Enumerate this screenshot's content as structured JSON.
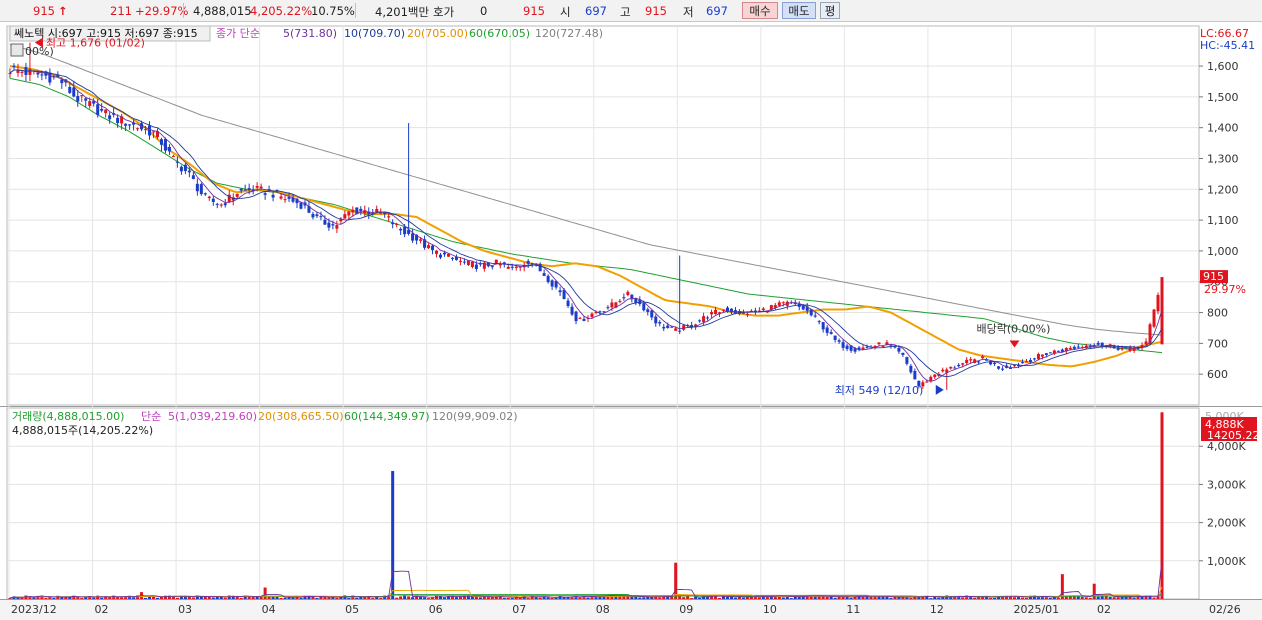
{
  "topbar": {
    "price": "915",
    "price_arrow": "↑",
    "change": "211",
    "change_pct": "+29.97%",
    "volume": "4,888,015",
    "volume_ratio": "4,205.22%",
    "turnover_rate": "10.75%",
    "amount": "4,201백만",
    "quote_label": "호가",
    "quote_value": "0",
    "quote_price": "915",
    "open_label": "시",
    "open_value": "697",
    "high_label": "고",
    "high_value": "915",
    "low_label": "저",
    "low_value": "697",
    "buy_label": "매수",
    "sell_label": "매도",
    "eval_label": "평"
  },
  "price_panel": {
    "stock_label": "쎄노텍 시:697 고:915 저:697 종:915",
    "pct_fragment": "00%)",
    "ma_title": "종가 단순",
    "ma5": "5(731.80)",
    "ma10": "10(709.70)",
    "ma20": "20(705.00)",
    "ma60": "60(670.05)",
    "ma120": "120(727.48)",
    "lc": "LC:66.67",
    "hc": "HC:-45.41",
    "high_annot": "최고 1,676 (01/02)",
    "low_annot": "최저 549 (12/10)",
    "div_annot": "배당락(0.00%)",
    "last_price_tag": "915",
    "last_pct_tag": "29.97%"
  },
  "volume_panel": {
    "title": "거래량(4,888,015.00)",
    "ma_title": "단순",
    "ma5": "5(1,039,219.60)",
    "ma20": "20(308,665.50)",
    "ma60": "60(144,349.97)",
    "ma120": "120(99,909.02)",
    "sub": "4,888,015주(14,205.22%)",
    "tag_top": "4,888K",
    "tag_bottom": "14205.22%",
    "top_clip": "5,000K"
  },
  "colors": {
    "up": "#e0141e",
    "down": "#1a3cc8",
    "ma5": "#7030a0",
    "ma10": "#1f3c9a",
    "ma20": "#f0a000",
    "ma60": "#20a030",
    "ma120": "#909090"
  },
  "chart_data": [
    {
      "type": "candlestick",
      "title": "쎄노텍",
      "x_ticks": [
        "2023/12",
        "02",
        "03",
        "04",
        "05",
        "06",
        "07",
        "08",
        "09",
        "10",
        "11",
        "12",
        "2025/01",
        "02",
        "02/26"
      ],
      "y_ticks": [
        600,
        700,
        800,
        900,
        1000,
        1100,
        1200,
        1300,
        1400,
        1500,
        1600
      ],
      "y_tick_labels": [
        "600",
        "700",
        "800",
        "900",
        "1,000",
        "1,100",
        "1,200",
        "1,300",
        "1,400",
        "1,500",
        "1,600"
      ],
      "ylim": [
        500,
        1730
      ],
      "last": {
        "open": 697,
        "high": 915,
        "low": 697,
        "close": 915
      },
      "high_point": {
        "value": 1676,
        "date": "01/02"
      },
      "low_point": {
        "value": 549,
        "date": "12/10"
      },
      "close_path": [
        1590,
        1580,
        1570,
        1560,
        1500,
        1470,
        1440,
        1420,
        1400,
        1380,
        1300,
        1250,
        1170,
        1150,
        1190,
        1200,
        1190,
        1170,
        1150,
        1100,
        1080,
        1130,
        1130,
        1120,
        1070,
        1040,
        1000,
        980,
        960,
        950,
        960,
        940,
        970,
        920,
        860,
        770,
        800,
        820,
        860,
        820,
        760,
        740,
        760,
        790,
        810,
        800,
        800,
        820,
        830,
        810,
        760,
        700,
        680,
        690,
        700,
        660,
        560,
        600,
        620,
        640,
        650,
        620,
        630,
        650,
        670,
        680,
        690,
        700,
        690,
        680,
        697,
        915
      ],
      "ma20_path": [
        1600,
        1590,
        1570,
        1530,
        1490,
        1450,
        1400,
        1330,
        1280,
        1220,
        1190,
        1200,
        1190,
        1170,
        1150,
        1130,
        1120,
        1120,
        1110,
        1070,
        1030,
        1000,
        980,
        960,
        950,
        960,
        950,
        920,
        880,
        840,
        830,
        820,
        800,
        790,
        790,
        800,
        810,
        810,
        820,
        800,
        760,
        720,
        680,
        660,
        650,
        640,
        630,
        625,
        640,
        660,
        690,
        705
      ],
      "ma60_path": [
        1560,
        1540,
        1500,
        1440,
        1390,
        1330,
        1270,
        1220,
        1200,
        1190,
        1170,
        1150,
        1120,
        1090,
        1060,
        1030,
        1010,
        990,
        975,
        960,
        950,
        940,
        920,
        900,
        880,
        860,
        850,
        840,
        830,
        820,
        810,
        800,
        790,
        780,
        750,
        720,
        700,
        690,
        680,
        670
      ],
      "ma120_path": [
        1670,
        1640,
        1600,
        1560,
        1520,
        1480,
        1440,
        1410,
        1380,
        1350,
        1320,
        1290,
        1260,
        1230,
        1200,
        1170,
        1140,
        1110,
        1080,
        1050,
        1020,
        1000,
        980,
        960,
        940,
        920,
        900,
        880,
        860,
        840,
        820,
        800,
        780,
        760,
        745,
        735,
        727
      ],
      "ma5_last": 731.8,
      "ma10_last": 709.7,
      "ma20_last": 705.0,
      "ma60_last": 670.05,
      "ma120_last": 727.48
    },
    {
      "type": "bar",
      "title": "거래량",
      "y_ticks": [
        1000,
        2000,
        3000,
        4000
      ],
      "y_tick_labels": [
        "1,000K",
        "2,000K",
        "3,000K",
        "4,000K"
      ],
      "ylim": [
        0,
        5000
      ],
      "unit": "K",
      "baseline_volume": 60,
      "spikes": [
        {
          "label": "2023/12",
          "value": 180
        },
        {
          "label": "03",
          "value": 300
        },
        {
          "label": "04",
          "value": 3350
        },
        {
          "label": "08",
          "value": 950
        },
        {
          "label": "2025/01",
          "value": 650
        },
        {
          "label": "02",
          "value": 400
        },
        {
          "label": "02/26",
          "value": 4888
        }
      ]
    }
  ]
}
